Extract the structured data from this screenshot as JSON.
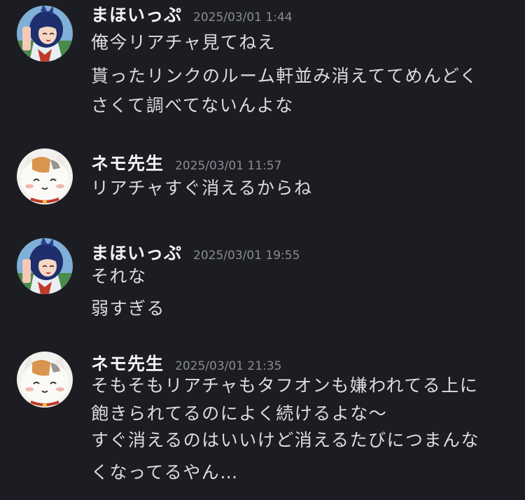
{
  "messages": [
    {
      "author": "まほいっぷ",
      "timestamp": "2025/03/01 1:44",
      "avatar": "girl-avatar-icon",
      "lines": [
        "俺今リアチャ見てねえ",
        "貰ったリンクのルーム軒並み消えててめんどく",
        "さくて調べてないんよな"
      ]
    },
    {
      "author": "ネモ先生",
      "timestamp": "2025/03/01 11:57",
      "avatar": "cat-avatar-icon",
      "lines": [
        "リアチャすぐ消えるからね"
      ]
    },
    {
      "author": "まほいっぷ",
      "timestamp": "2025/03/01 19:55",
      "avatar": "girl-avatar-icon",
      "lines": [
        "それな",
        "弱すぎる"
      ]
    },
    {
      "author": "ネモ先生",
      "timestamp": "2025/03/01 21:35",
      "avatar": "cat-avatar-icon",
      "lines": [
        "そもそもリアチャもタフオンも嫌われてる上に",
        "飽きられてるのによく続けるよな〜",
        "すぐ消えるのはいいけど消えるたびにつまんな",
        "くなってるやん…"
      ]
    }
  ]
}
